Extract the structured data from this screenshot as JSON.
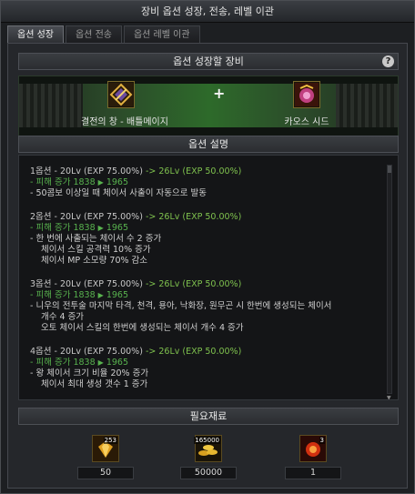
{
  "window": {
    "title": "장비 옵션 성장, 전송, 레벨 이관"
  },
  "tabs": [
    {
      "label": "옵션 성장",
      "active": true
    },
    {
      "label": "옵션 전송",
      "active": false
    },
    {
      "label": "옵션 레벨 이관",
      "active": false
    }
  ],
  "growth": {
    "header": "옵션 성장할 장비",
    "help_icon": "question-icon",
    "source_item": {
      "label": "결전의 창 - 배틀메이지",
      "icon": "spear-icon"
    },
    "plus": "+",
    "target_item": {
      "label": "카오스 시드",
      "icon": "chaos-seed-icon"
    }
  },
  "description": {
    "header": "옵션 설명",
    "options": [
      {
        "title": "1옵션 - 20Lv (EXP 75.00%)",
        "to": "-> 26Lv (EXP 50.00%)",
        "damage": "- 피해 증가 1838",
        "damage_to": "1965",
        "effects": [
          "- 50콤보 이상일 때 체이서 사출이 자동으로 발동"
        ]
      },
      {
        "title": "2옵션 - 20Lv (EXP 75.00%)",
        "to": "-> 26Lv (EXP 50.00%)",
        "damage": "- 피해 증가 1838",
        "damage_to": "1965",
        "effects": [
          "- 한 번에 사출되는 체이서 수 2 증가",
          "체이서 스킬 공격력 10% 증가",
          "체이서 MP 소모량 70% 감소"
        ]
      },
      {
        "title": "3옵션 - 20Lv (EXP 75.00%)",
        "to": "-> 26Lv (EXP 50.00%)",
        "damage": "- 피해 증가 1838",
        "damage_to": "1965",
        "effects": [
          "- 니우의 전투술 마지막 타격, 천격, 용아, 낙화장, 원무곤 시 한번에 생성되는 체이서",
          "개수 4 증가",
          "오토 체이서 스킬의 한번에 생성되는 체이서 개수 4 증가"
        ]
      },
      {
        "title": "4옵션 - 20Lv (EXP 75.00%)",
        "to": "-> 26Lv (EXP 50.00%)",
        "damage": "- 피해 증가 1838",
        "damage_to": "1965",
        "effects": [
          "- 왕 체이서 크기 비율 20% 증가",
          "체이서 최대 생성 갯수 1 증가"
        ]
      }
    ]
  },
  "materials": {
    "header": "필요재료",
    "items": [
      {
        "icon": "gold-crystal-icon",
        "badge": "253",
        "amount": "50"
      },
      {
        "icon": "gold-coins-icon",
        "badge": "165000",
        "amount": "50000"
      },
      {
        "icon": "fire-orb-icon",
        "badge": "3",
        "amount": "1"
      }
    ]
  }
}
